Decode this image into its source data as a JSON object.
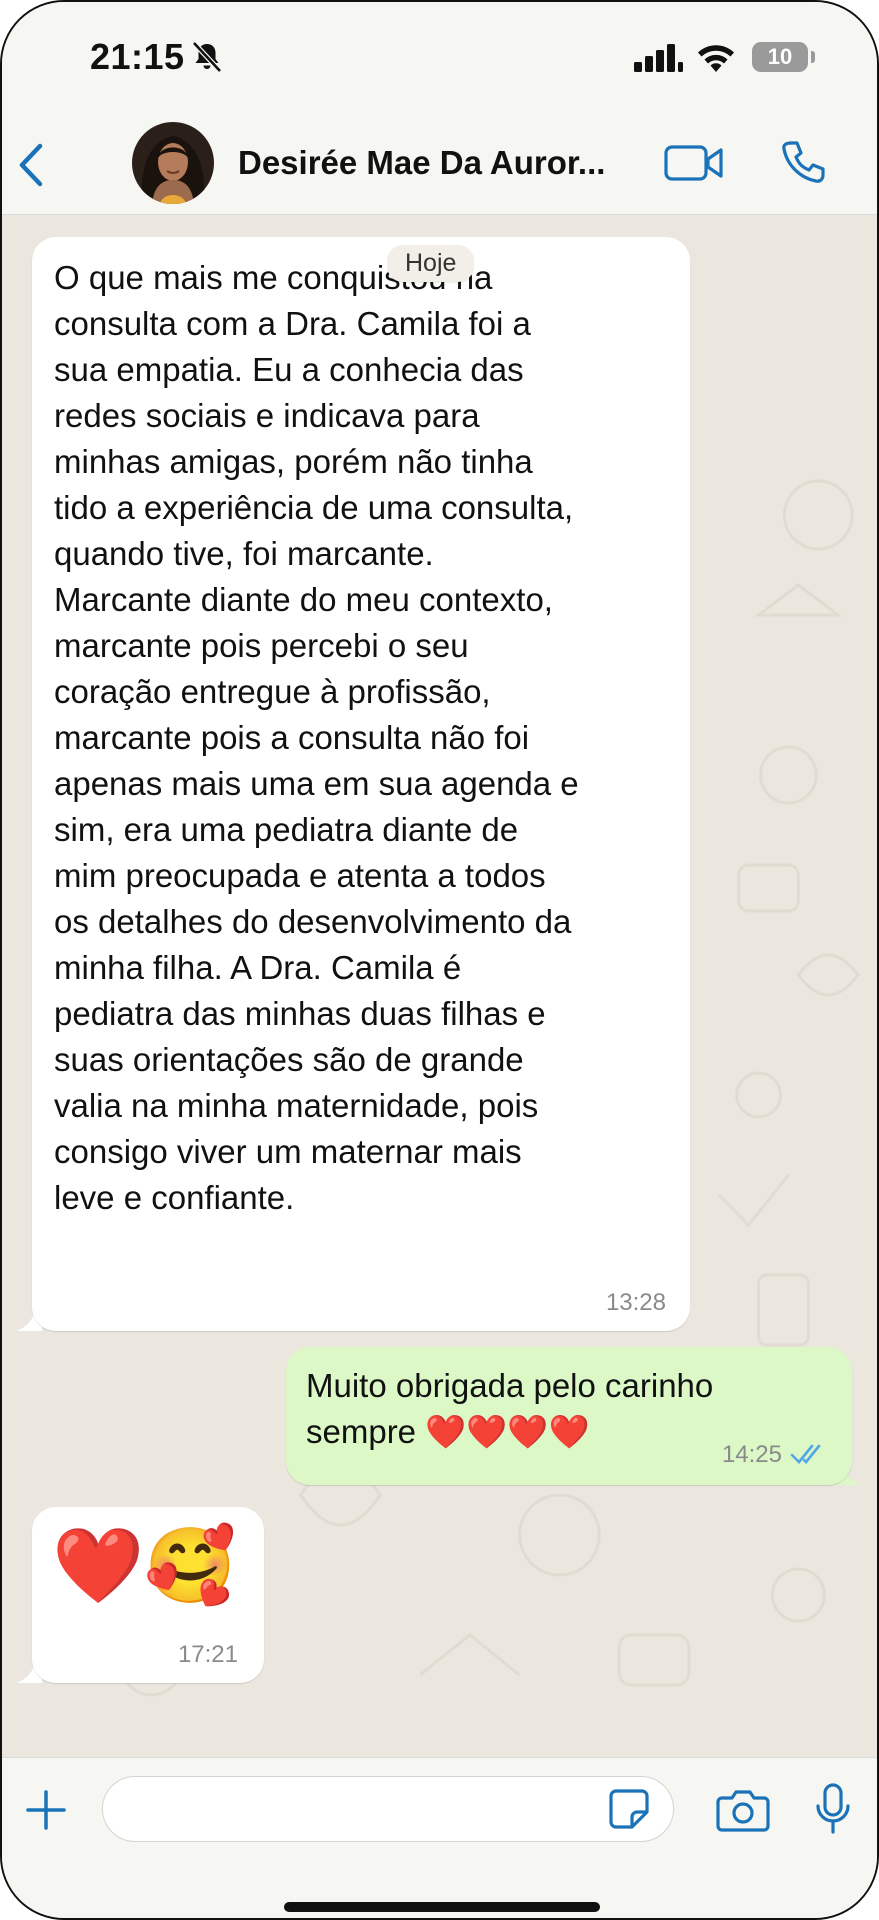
{
  "status_bar": {
    "time": "21:15",
    "battery": "10",
    "icons": [
      "bell-slash-icon",
      "signal-icon",
      "wifi-icon",
      "battery-icon"
    ]
  },
  "header": {
    "contact_name": "Desirée Mae Da Auror...",
    "icons": [
      "back-chevron-icon",
      "video-call-icon",
      "phone-icon"
    ],
    "accent_color": "#1a73b8"
  },
  "chat": {
    "date_chip": "Hoje",
    "messages": [
      {
        "direction": "incoming",
        "text": "O que mais me conquistou na\nconsulta com a Dra. Camila foi a\nsua empatia. Eu a conhecia das\nredes sociais e indicava para\nminhas amigas, porém não tinha\ntido a experiência de uma consulta,\nquando tive, foi marcante.\nMarcante diante do meu contexto,\nmarcante pois percebi o seu\ncoração entregue à profissão,\nmarcante pois a consulta não foi\napenas mais uma em sua agenda e\nsim, era uma pediatra diante de\nmim preocupada e atenta a todos\nos detalhes do desenvolvimento da\nminha filha. A Dra. Camila é\npediatra das minhas duas filhas e\nsuas orientações são de grande\nvalia na minha maternidade, pois\nconsigo viver um maternar mais\nleve e confiante.",
        "time": "13:28"
      },
      {
        "direction": "outgoing",
        "text": "Muito obrigada pelo carinho\nsempre ❤️❤️❤️❤️",
        "time": "14:25",
        "status": "read"
      },
      {
        "direction": "incoming",
        "text": "❤️🥰",
        "time": "17:21"
      }
    ]
  },
  "input_bar": {
    "placeholder": "",
    "icons": [
      "plus-icon",
      "sticker-icon",
      "camera-icon",
      "microphone-icon"
    ]
  },
  "colors": {
    "incoming_bubble": "#ffffff",
    "outgoing_bubble": "#dcf8c6",
    "chat_background": "#ebe6de",
    "read_ticks": "#53a6e8"
  }
}
